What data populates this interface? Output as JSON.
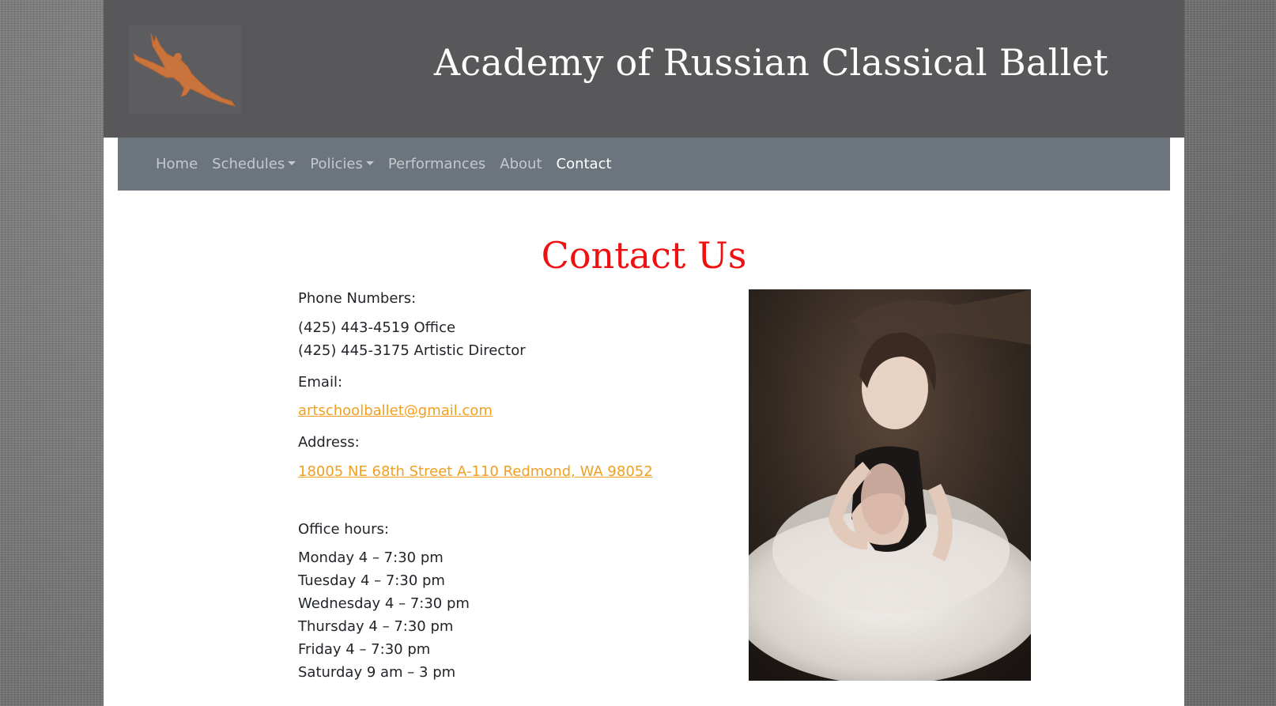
{
  "site": {
    "title": "Academy of Russian Classical Ballet",
    "logo_icon": "ballet-dancer-leap-icon",
    "logo_color": "#c8743c"
  },
  "nav": {
    "items": [
      {
        "label": "Home",
        "dropdown": false,
        "active": false
      },
      {
        "label": "Schedules",
        "dropdown": true,
        "active": false
      },
      {
        "label": "Policies",
        "dropdown": true,
        "active": false
      },
      {
        "label": "Performances",
        "dropdown": false,
        "active": false
      },
      {
        "label": "About",
        "dropdown": false,
        "active": false
      },
      {
        "label": "Contact",
        "dropdown": false,
        "active": true
      }
    ]
  },
  "contact": {
    "heading": "Contact Us",
    "heading_color": "#ee1111",
    "phone_label": "Phone Numbers:",
    "phones": [
      "(425) 443-4519 Office",
      "(425) 445-3175 Artistic Director"
    ],
    "email_label": "Email:",
    "email": "artschoolballet@gmail.com",
    "address_label": "Address:",
    "address": "18005 NE 68th Street A-110 Redmond, WA 98052",
    "hours_label": "Office hours:",
    "hours": [
      "Monday 4 – 7:30 pm",
      "Tuesday 4 – 7:30 pm",
      "Wednesday 4 – 7:30 pm",
      "Thursday 4 – 7:30 pm",
      "Friday 4 – 7:30 pm",
      "Saturday 9 am – 3 pm"
    ],
    "link_color": "#f0a020"
  },
  "colors": {
    "header_bg": "#58585b",
    "navbar_bg": "#6c757d"
  }
}
